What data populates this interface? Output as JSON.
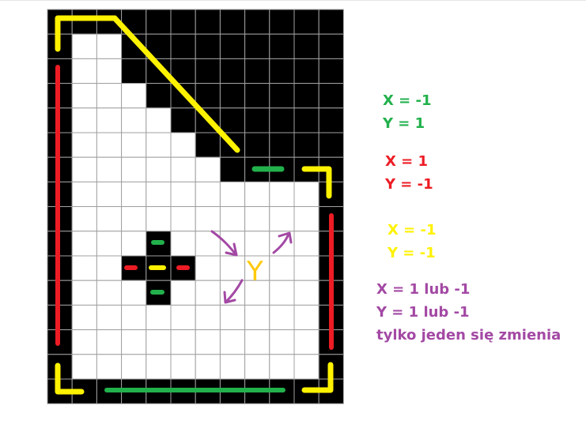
{
  "colors": {
    "grid_line": "#a0a0a0",
    "cell_white": "#ffffff",
    "cell_black": "#000000",
    "green": "#22b14c",
    "red": "#ed1c24",
    "yellow": "#fff200",
    "purple": "#a349a4",
    "orange": "#ffc90e"
  },
  "grid": {
    "columns": 12,
    "rows": 16,
    "rows_black": [
      [
        0,
        0,
        0,
        0,
        0,
        0,
        0,
        0,
        0,
        0,
        0,
        0
      ],
      [
        0,
        1,
        1,
        0,
        0,
        0,
        0,
        0,
        0,
        0,
        0,
        0
      ],
      [
        0,
        1,
        1,
        0,
        0,
        0,
        0,
        0,
        0,
        0,
        0,
        0
      ],
      [
        0,
        1,
        1,
        1,
        0,
        0,
        0,
        0,
        0,
        0,
        0,
        0
      ],
      [
        0,
        1,
        1,
        1,
        1,
        0,
        0,
        0,
        0,
        0,
        0,
        0
      ],
      [
        0,
        1,
        1,
        1,
        1,
        1,
        0,
        0,
        0,
        0,
        0,
        0
      ],
      [
        0,
        1,
        1,
        1,
        1,
        1,
        1,
        0,
        0,
        0,
        0,
        0
      ],
      [
        0,
        1,
        1,
        1,
        1,
        1,
        1,
        1,
        1,
        1,
        1,
        0
      ],
      [
        0,
        1,
        1,
        1,
        1,
        1,
        1,
        1,
        1,
        1,
        1,
        0
      ],
      [
        0,
        1,
        1,
        1,
        0,
        1,
        1,
        1,
        1,
        1,
        1,
        0
      ],
      [
        0,
        1,
        1,
        0,
        0,
        0,
        1,
        1,
        1,
        1,
        1,
        0
      ],
      [
        0,
        1,
        1,
        1,
        0,
        1,
        1,
        1,
        1,
        1,
        1,
        0
      ],
      [
        0,
        1,
        1,
        1,
        1,
        1,
        1,
        1,
        1,
        1,
        1,
        0
      ],
      [
        0,
        1,
        1,
        1,
        1,
        1,
        1,
        1,
        1,
        1,
        1,
        0
      ],
      [
        0,
        1,
        1,
        1,
        1,
        1,
        1,
        1,
        1,
        1,
        1,
        0
      ],
      [
        0,
        0,
        0,
        0,
        0,
        0,
        0,
        0,
        0,
        0,
        0,
        0
      ]
    ]
  },
  "marker_glyph": "Y",
  "legend": {
    "green": [
      "X = -1",
      "Y = 1"
    ],
    "red": [
      "X = 1",
      "Y = -1"
    ],
    "yellow": [
      "X = -1",
      "Y = -1"
    ],
    "purple": [
      "X = 1 lub -1",
      "Y = 1 lub -1",
      "tylko jeden się zmienia"
    ]
  }
}
